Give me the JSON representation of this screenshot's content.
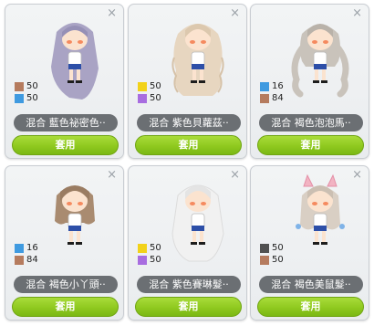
{
  "close_symbol": "×",
  "cards": [
    {
      "name": "混合 藍色祕密色‧‧",
      "button": "套用",
      "hair_color": "#a9a3c4",
      "hair_style": "long-straight",
      "swatches": [
        {
          "color": "#b57b5e",
          "value": "50"
        },
        {
          "color": "#3f9ae0",
          "value": "50"
        }
      ]
    },
    {
      "name": "混合 紫色貝蘿茲‧‧",
      "button": "套用",
      "hair_color": "#e7d6c0",
      "hair_style": "long-wavy",
      "swatches": [
        {
          "color": "#f2d21a",
          "value": "50"
        },
        {
          "color": "#a86de0",
          "value": "50"
        }
      ]
    },
    {
      "name": "混合 褐色泡泡馬‧‧",
      "button": "套用",
      "hair_color": "#c9c3bb",
      "hair_style": "long-twin",
      "swatches": [
        {
          "color": "#3f9ae0",
          "value": "16"
        },
        {
          "color": "#b57b5e",
          "value": "84"
        }
      ]
    },
    {
      "name": "混合 褐色小丫頭‧‧",
      "button": "套用",
      "hair_color": "#a98b70",
      "hair_style": "bob",
      "swatches": [
        {
          "color": "#3f9ae0",
          "value": "16"
        },
        {
          "color": "#b57b5e",
          "value": "84"
        }
      ]
    },
    {
      "name": "混合 紫色賽琳髮‧‧",
      "button": "套用",
      "hair_color": "#eeeeee",
      "hair_style": "long-straight",
      "swatches": [
        {
          "color": "#f2d21a",
          "value": "50"
        },
        {
          "color": "#a86de0",
          "value": "50"
        }
      ]
    },
    {
      "name": "混合 褐色美鼠髮‧‧",
      "button": "套用",
      "hair_color": "#d9cfc4",
      "hair_style": "cat-ears",
      "swatches": [
        {
          "color": "#505050",
          "value": "50"
        },
        {
          "color": "#b57b5e",
          "value": "50"
        }
      ]
    }
  ]
}
